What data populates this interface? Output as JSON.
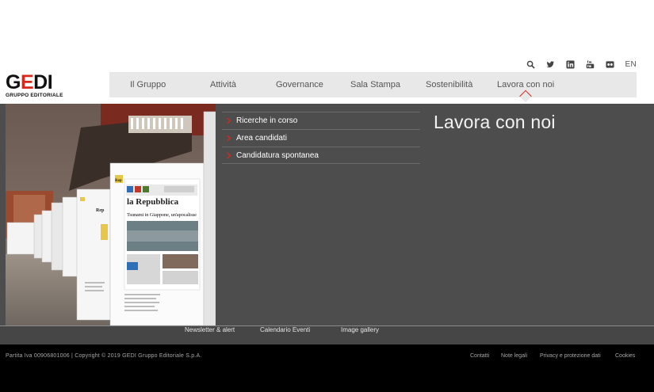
{
  "header": {
    "logo": {
      "text": "GEDI",
      "subtitle": "GRUPPO EDITORIALE"
    },
    "utility_icons": [
      "search-icon",
      "twitter-icon",
      "linkedin-icon",
      "youtube-icon",
      "flickr-icon"
    ],
    "language": "EN"
  },
  "nav": {
    "items": [
      {
        "label": "Il Gruppo"
      },
      {
        "label": "Attività"
      },
      {
        "label": "Governance"
      },
      {
        "label": "Sala Stampa"
      },
      {
        "label": "Sostenibilità"
      },
      {
        "label": "Lavora con noi",
        "active": true
      }
    ]
  },
  "hero": {
    "image": {
      "newspaper_masthead": "la Repubblica",
      "headline": "Tsunami in Giappone, un'apocalisse",
      "side_label": "Rep"
    },
    "submenu": [
      {
        "label": "Ricerche in corso"
      },
      {
        "label": "Area candidati"
      },
      {
        "label": "Candidatura spontanea"
      }
    ],
    "title": "Lavora con noi"
  },
  "footer_links": [
    {
      "label": "Newsletter & alert"
    },
    {
      "label": "Calendario Eventi"
    },
    {
      "label": "Image gallery"
    }
  ],
  "bottom": {
    "copyright": "Partita Iva 00906801006 | Copyright © 2019 GEDI Gruppo Editoriale S.p.A.",
    "links": [
      {
        "label": "Contatti"
      },
      {
        "label": "Note legali"
      },
      {
        "label": "Privacy e protezione dati"
      },
      {
        "label": "Cookies"
      }
    ]
  },
  "colors": {
    "brand_red": "#d8281b",
    "nav_bg": "#e8e8e8",
    "hero_bg": "#4d4d4d",
    "bottom_bg": "#000000"
  }
}
